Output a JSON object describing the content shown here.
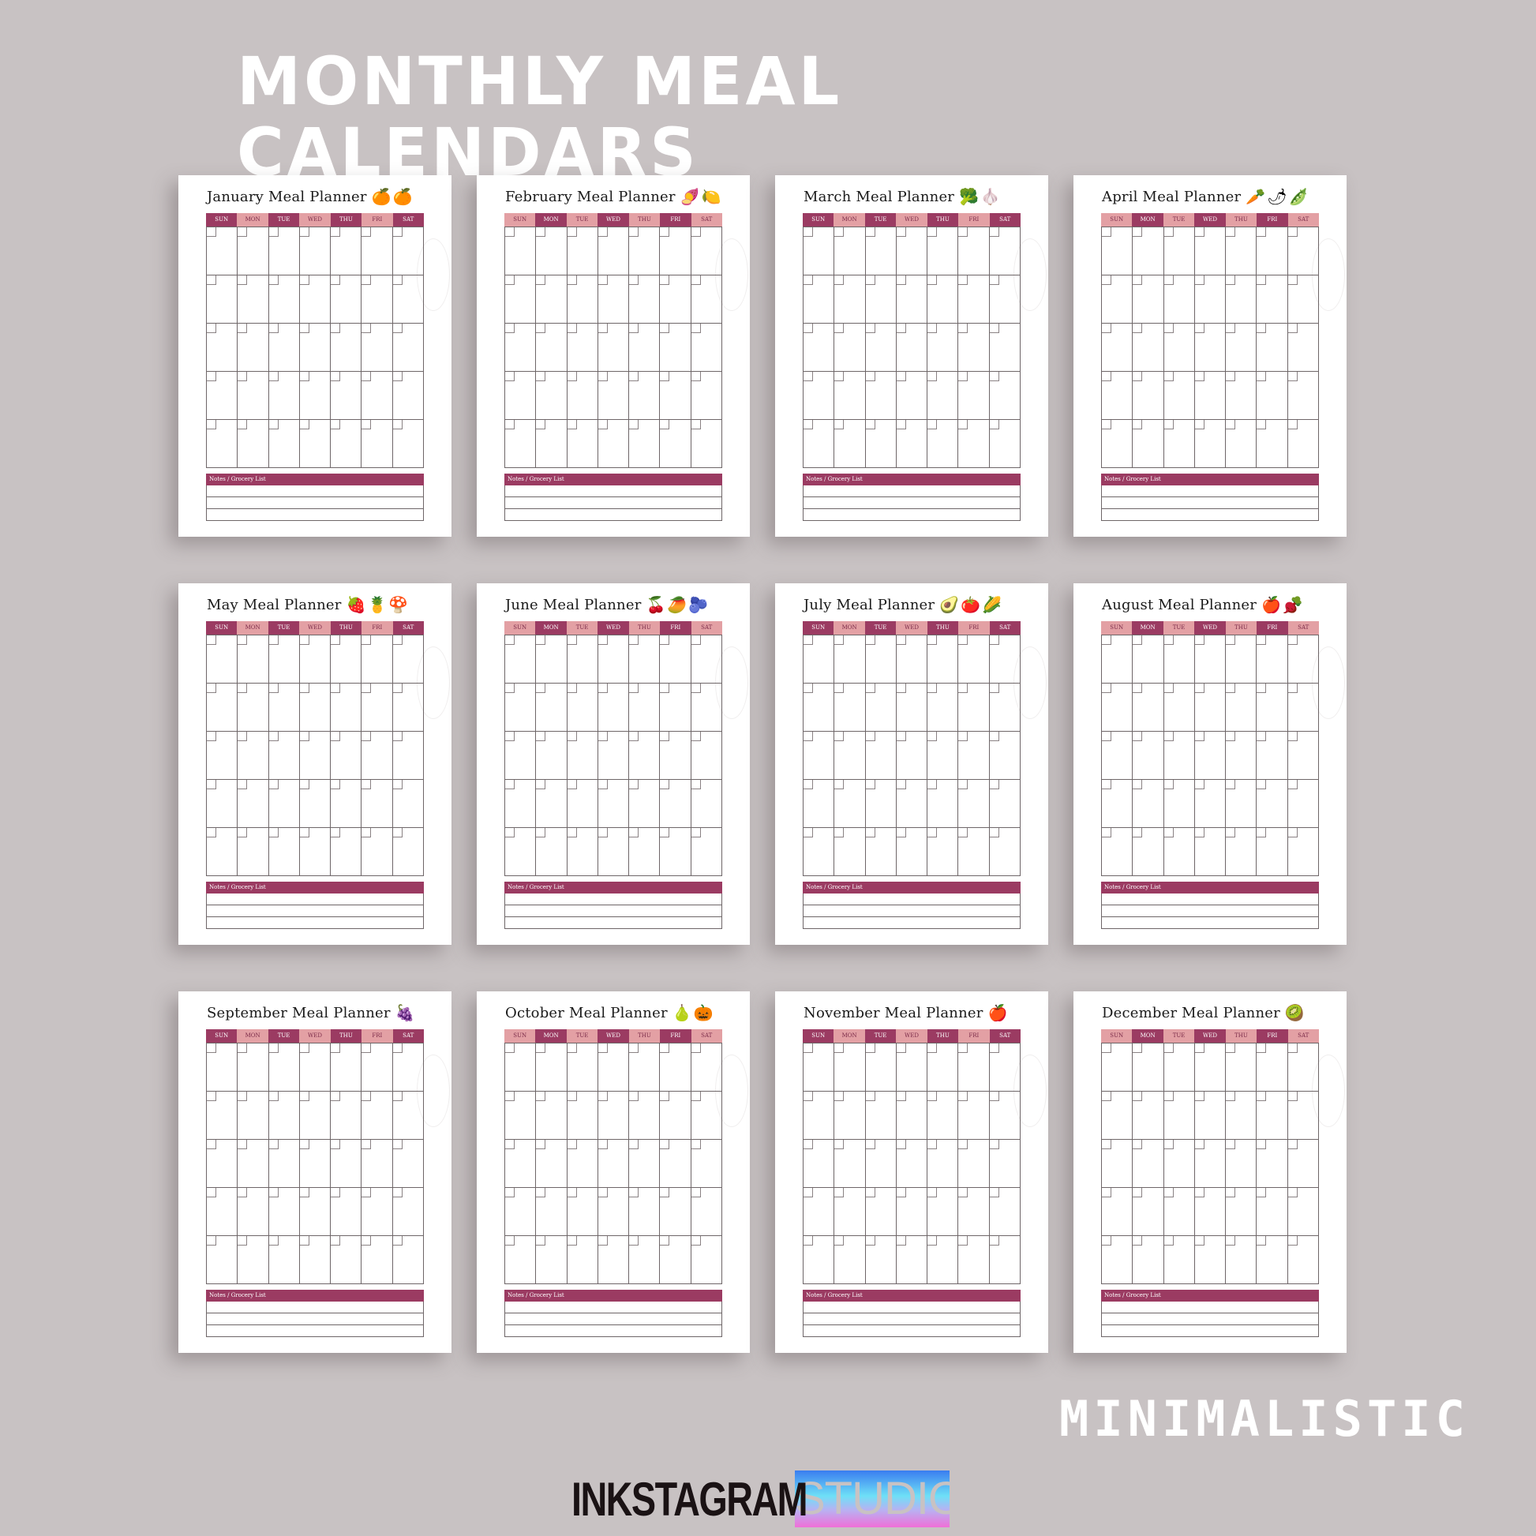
{
  "headline": "MONTHLY MEAL CALENDARS",
  "subtitle": "MINIMALISTIC",
  "brand": {
    "part1": "INKSTAGRAM",
    "part2": "STUDIO"
  },
  "colors": {
    "background": "#c8c2c3",
    "header_dark": "#9b3b62",
    "header_light": "#e3a0a4",
    "notes_bar": "#9b3b62",
    "grid_line": "#6e6668"
  },
  "weekdays": [
    "SUN",
    "MON",
    "TUE",
    "WED",
    "THU",
    "FRI",
    "SAT"
  ],
  "notes_label": "Notes / Grocery List",
  "weeks_per_month": 5,
  "notes_lines": 3,
  "planners": [
    {
      "title": "January Meal Planner",
      "icons": [
        "grapefruit-icon",
        "orange-icon"
      ],
      "emoji": "🍊🍊",
      "header_start": "dark"
    },
    {
      "title": "February Meal Planner",
      "icons": [
        "sweet-potato-icon",
        "lemon-icon"
      ],
      "emoji": "🍠🍋",
      "header_start": "light"
    },
    {
      "title": "March Meal Planner",
      "icons": [
        "broccoli-icon",
        "garlic-icon"
      ],
      "emoji": "🥦🧄",
      "header_start": "dark"
    },
    {
      "title": "April Meal Planner",
      "icons": [
        "carrot-icon",
        "radish-icon",
        "pea-pod-icon"
      ],
      "emoji": "🥕🌶🫛",
      "header_start": "light"
    },
    {
      "title": "May Meal Planner",
      "icons": [
        "strawberry-icon",
        "pineapple-icon",
        "mushroom-icon"
      ],
      "emoji": "🍓🍍🍄",
      "header_start": "dark"
    },
    {
      "title": "June Meal Planner",
      "icons": [
        "cherry-icon",
        "papaya-icon",
        "blueberry-icon"
      ],
      "emoji": "🍒🥭🫐",
      "header_start": "light"
    },
    {
      "title": "July Meal Planner",
      "icons": [
        "avocado-icon",
        "tomato-icon",
        "corn-icon"
      ],
      "emoji": "🥑🍅🌽",
      "header_start": "dark"
    },
    {
      "title": "August Meal Planner",
      "icons": [
        "apple-icon",
        "beet-icon"
      ],
      "emoji": "🍎🫜",
      "header_start": "light"
    },
    {
      "title": "September Meal Planner",
      "icons": [
        "grapes-icon"
      ],
      "emoji": "🍇",
      "header_start": "dark"
    },
    {
      "title": "October Meal Planner",
      "icons": [
        "pear-icon",
        "pumpkin-icon"
      ],
      "emoji": "🍐🎃",
      "header_start": "light"
    },
    {
      "title": "November Meal Planner",
      "icons": [
        "pomegranate-icon"
      ],
      "emoji": "🍎",
      "header_start": "dark"
    },
    {
      "title": "December Meal Planner",
      "icons": [
        "kiwi-icon"
      ],
      "emoji": "🥝",
      "header_start": "light"
    }
  ]
}
